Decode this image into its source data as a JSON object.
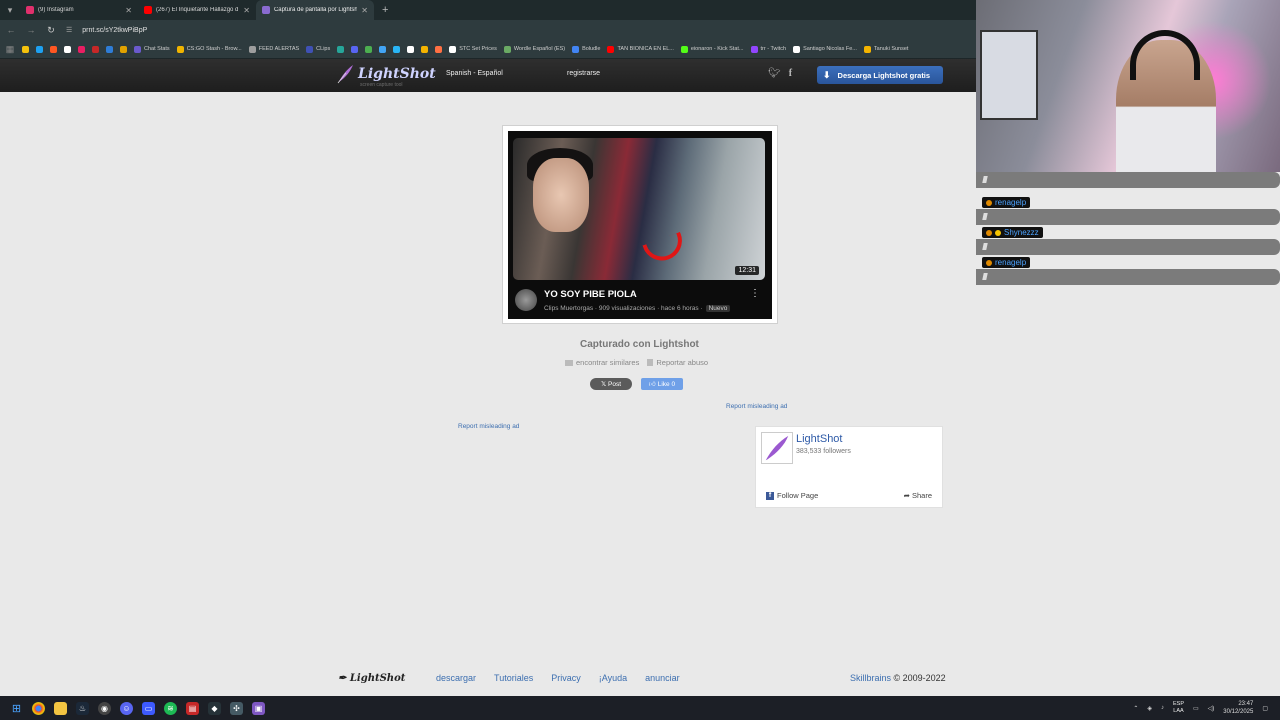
{
  "browser": {
    "tabs": [
      {
        "label": "(9) Instagram",
        "color": "#e1306c",
        "active": false
      },
      {
        "label": "(267) El Inquietante Hallazgo d",
        "color": "#ff0000",
        "active": false
      },
      {
        "label": "Captura de pantalla por Lightsh",
        "color": "#8a6bd1",
        "active": true
      }
    ],
    "url": "prnt.sc/sY2tkwPiBpP",
    "bookmarks": [
      {
        "label": "",
        "color": "#f4c20d"
      },
      {
        "label": "",
        "color": "#1da1f2"
      },
      {
        "label": "",
        "color": "#ff5722"
      },
      {
        "label": "",
        "color": "#ffffff"
      },
      {
        "label": "",
        "color": "#e91e63"
      },
      {
        "label": "",
        "color": "#c62828"
      },
      {
        "label": "",
        "color": "#2e7dd7"
      },
      {
        "label": "",
        "color": "#e0a200"
      },
      {
        "label": "Chat Stats",
        "color": "#6a5acd"
      },
      {
        "label": "CS:GO Stash - Brow...",
        "color": "#f0b400"
      },
      {
        "label": "FEED ALERTAS",
        "color": "#9e9e9e"
      },
      {
        "label": "CLips",
        "color": "#3f51b5"
      },
      {
        "label": "",
        "color": "#26a69a"
      },
      {
        "label": "",
        "color": "#5865f2"
      },
      {
        "label": "",
        "color": "#4caf50"
      },
      {
        "label": "",
        "color": "#42a5f5"
      },
      {
        "label": "",
        "color": "#29b6f6"
      },
      {
        "label": "",
        "color": "#ffffff"
      },
      {
        "label": "",
        "color": "#f4b400"
      },
      {
        "label": "",
        "color": "#ff7043"
      },
      {
        "label": "STC Set Prices",
        "color": "#ffffff"
      },
      {
        "label": "Wordle Español (ES)",
        "color": "#6aaa64"
      },
      {
        "label": "Boludle",
        "color": "#4285f4"
      },
      {
        "label": "TAN BIONICA EN EL...",
        "color": "#ff0000"
      },
      {
        "label": "eionaron - Kick Stat...",
        "color": "#53fc18"
      },
      {
        "label": "trr - Twitch",
        "color": "#9146ff"
      },
      {
        "label": "Santiago Nicolas Fe...",
        "color": "#ffffff"
      },
      {
        "label": "Tanuki Sunset",
        "color": "#f4b400"
      }
    ]
  },
  "lightshot": {
    "brand": "LightShot",
    "brand_sub": "screen capture tool",
    "language": "Spanish - Español",
    "register": "registrarse",
    "download_btn": "Descarga Lightshot gratis",
    "captured_with": "Capturado con Lightshot",
    "find_similar": "encontrar similares",
    "report_abuse": "Reportar abuso",
    "tweet": "Post",
    "like": "Like 0",
    "report_ad_1": "Report misleading ad",
    "report_ad_2": "Report misleading ad"
  },
  "video": {
    "title": "YO SOY PIBE PIOLA",
    "meta": "Clips Muertorgas · 909 visualizaciones · hace 6 horas ·",
    "badge": "Nuevo",
    "duration": "12:31"
  },
  "fb_widget": {
    "name": "LightShot",
    "followers": "383,533 followers",
    "follow": "Follow Page",
    "share": "Share"
  },
  "footer": {
    "logo": "LightShot",
    "links": [
      "descargar",
      "Tutoriales",
      "Privacy",
      "¡Ayuda",
      "anunciar"
    ],
    "company": "Skillbrains",
    "copyright": " © 2009-2022"
  },
  "chat": [
    {
      "user": ""
    },
    {
      "user": "renagelp"
    },
    {
      "user": "Shynezzz"
    },
    {
      "user": "renagelp"
    }
  ],
  "taskbar": {
    "lang": "ESP",
    "lang2": "LAA",
    "time": "23:47",
    "date": "30/12/2025"
  }
}
